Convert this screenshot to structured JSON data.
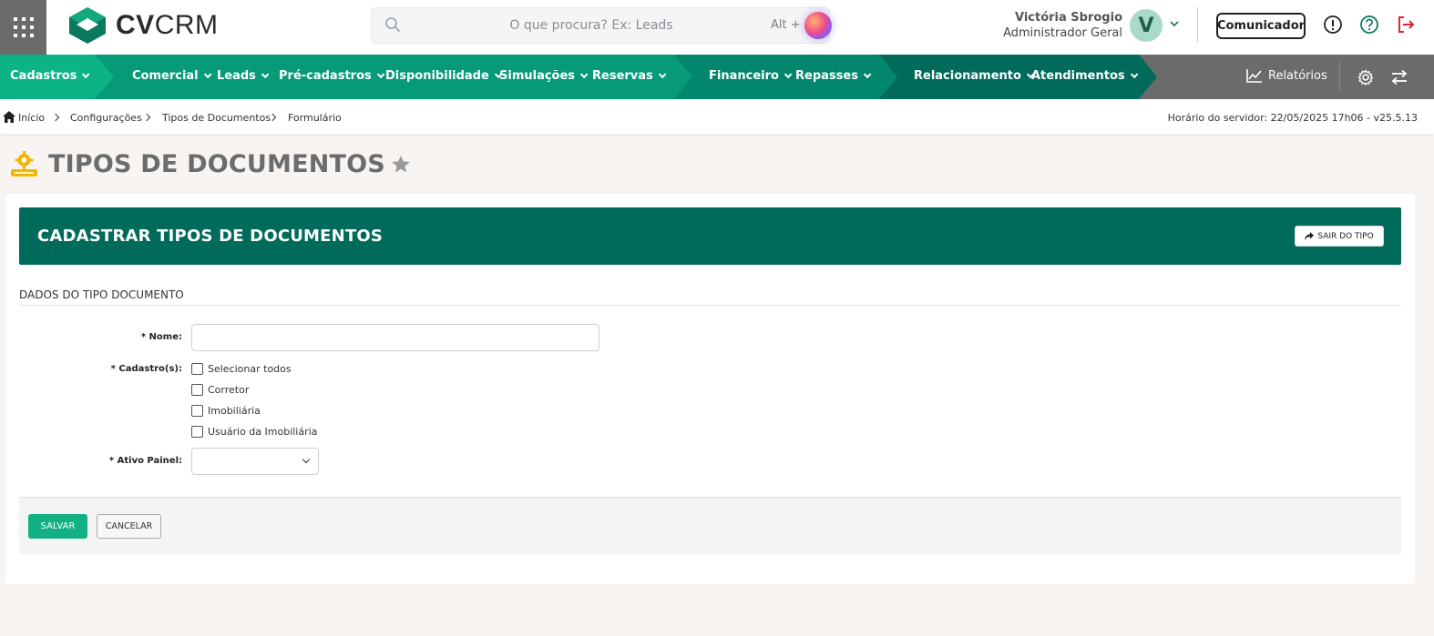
{
  "header": {
    "logo_bold": "CV",
    "logo_light": "CRM",
    "search_placeholder": "O que procura? Ex: Leads",
    "search_shortcut": "Alt + G",
    "user_name": "Victória Sbrogio",
    "user_role": "Administrador Geral",
    "avatar_initial": "V",
    "comunicador_label": "Comunicador"
  },
  "nav": {
    "items": [
      {
        "label": "Cadastros"
      },
      {
        "label": "Comercial"
      },
      {
        "label": "Leads"
      },
      {
        "label": "Pré-cadastros"
      },
      {
        "label": "Disponibilidade"
      },
      {
        "label": "Simulações"
      },
      {
        "label": "Reservas"
      },
      {
        "label": "Financeiro"
      },
      {
        "label": "Repasses"
      },
      {
        "label": "Relacionamento"
      },
      {
        "label": "Atendimentos"
      }
    ],
    "reports_label": "Relatórios"
  },
  "breadcrumb": {
    "items": [
      "Início",
      "Configurações",
      "Tipos de Documentos",
      "Formulário"
    ],
    "server_time": "Horário do servidor: 22/05/2025 17h06 - v25.5.13"
  },
  "page": {
    "title": "TIPOS DE DOCUMENTOS"
  },
  "form": {
    "header_title": "CADASTRAR TIPOS DE DOCUMENTOS",
    "exit_label": "SAIR DO TIPO",
    "section_title": "DADOS DO TIPO DOCUMENTO",
    "nome_label": "* Nome:",
    "nome_value": "",
    "cadastros_label": "* Cadastro(s):",
    "cadastros_options": [
      "Selecionar todos",
      "Corretor",
      "Imobiliária",
      "Usuário da Imobiliária"
    ],
    "ativo_label": "* Ativo Painel:",
    "ativo_value": "",
    "save_label": "SALVAR",
    "cancel_label": "CANCELAR"
  },
  "colors": {
    "nav_green_light": "#0cb386",
    "nav_green_mid": "#069a79",
    "nav_green_dark": "#006a5b",
    "nav_gray": "#6b6b6b",
    "form_header": "#006a5b",
    "save_button": "#12b184"
  }
}
